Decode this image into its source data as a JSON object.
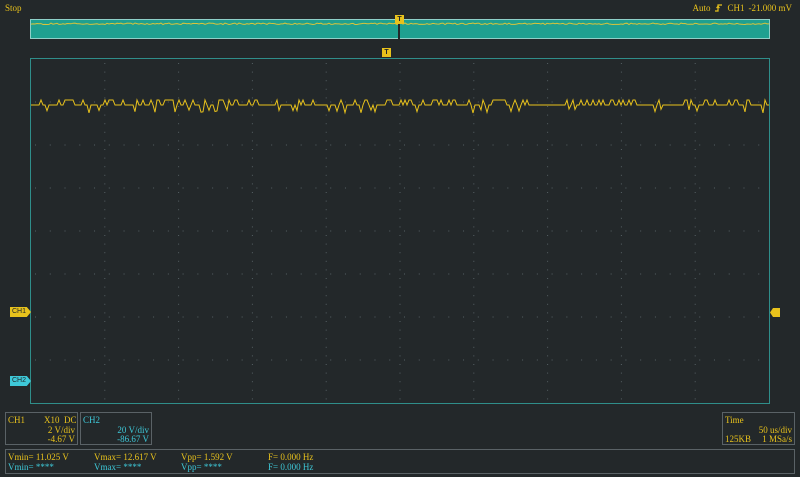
{
  "status": "Stop",
  "trigger": {
    "mode": "Auto",
    "edge_icon": "rising-edge-icon",
    "channel": "CH1",
    "level": "-21.000 mV"
  },
  "markers": {
    "trigger_time": "T",
    "ch1": "CH1",
    "ch2": "CH2"
  },
  "ch1": {
    "name": "CH1",
    "probe": "X10",
    "coupling": "DC",
    "scale": "2 V/div",
    "offset": "-4.67 V"
  },
  "ch2": {
    "name": "CH2",
    "scale": "20 V/div",
    "offset": "-86.67 V"
  },
  "timebase": {
    "label": "Time",
    "scale": "50 us/div",
    "memory": "125KB",
    "rate": "1 MSa/s"
  },
  "measurements": {
    "ch1": {
      "vmin": "Vmin= 11.025 V",
      "vmax": "Vmax= 12.617 V",
      "vpp": "Vpp= 1.592 V",
      "freq": "F= 0.000 Hz"
    },
    "ch2": {
      "vmin": "Vmin= ****",
      "vmax": "Vmax= ****",
      "vpp": "Vpp= ****",
      "freq": "F= 0.000 Hz"
    }
  },
  "colors": {
    "ch1": "#e8c21c",
    "ch2": "#3ec8d8",
    "background": "#23282a",
    "grid": "#2f8e8a"
  }
}
